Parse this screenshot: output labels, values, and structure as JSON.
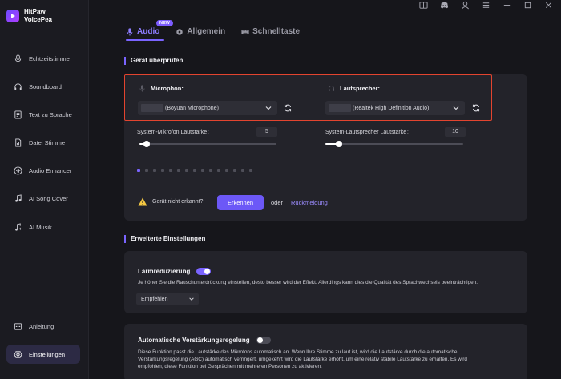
{
  "app": {
    "name_line1": "HitPaw",
    "name_line2": "VoicePea"
  },
  "sidebar": {
    "items": [
      {
        "label": "Echtzeitstimme",
        "icon": "microphone-icon"
      },
      {
        "label": "Soundboard",
        "icon": "headphones-icon"
      },
      {
        "label": "Text zu Sprache",
        "icon": "document-text-icon"
      },
      {
        "label": "Datei Stimme",
        "icon": "file-icon"
      },
      {
        "label": "Audio Enhancer",
        "icon": "waveform-icon"
      },
      {
        "label": "AI Song Cover",
        "icon": "music-note-icon"
      },
      {
        "label": "AI Musik",
        "icon": "music-ai-icon"
      }
    ],
    "bottom_items": [
      {
        "label": "Anleitung",
        "icon": "book-icon"
      },
      {
        "label": "Einstellungen",
        "icon": "gear-icon",
        "active": true
      }
    ]
  },
  "topbar": [
    "book-icon",
    "discord-icon",
    "user-icon",
    "menu-icon",
    "minimize-icon",
    "maximize-icon",
    "close-icon"
  ],
  "tabs": [
    {
      "label": "Audio",
      "icon": "microphone-icon",
      "active": true,
      "badge": "NEW"
    },
    {
      "label": "Allgemein",
      "icon": "gear-icon",
      "active": false
    },
    {
      "label": "Schnelltaste",
      "icon": "keyboard-icon",
      "active": false
    }
  ],
  "device_check": {
    "title": "Gerät überprüfen",
    "microphone": {
      "label": "Microphon:",
      "value": "(Boyuan Microphone)"
    },
    "speaker": {
      "label": "Lautsprecher:",
      "value": "(Realtek High Definition Audio)"
    },
    "mic_volume": {
      "label": "System-Mikrofon Lautstärke：",
      "value": "5",
      "level": 5
    },
    "speaker_volume": {
      "label": "System-Lautsprecher Lautstärke：",
      "value": "10",
      "level": 10
    },
    "level_meter": {
      "active_count": 1,
      "total_count": 15
    },
    "not_detected": "Gerät nicht erkannt?",
    "detect_button": "Erkennen",
    "or": "oder",
    "feedback_link": "Rückmeldung"
  },
  "advanced": {
    "title": "Erweiterte Einstellungen",
    "noise": {
      "title": "Lärmreduzierung",
      "enabled": true,
      "description": "Je höher Sie die Rauschunterdrückung einstellen, desto besser wird der Effekt. Allerdings kann dies die Qualität des Sprachwechsels beeinträchtigen.",
      "dropdown_value": "Empfehlen"
    },
    "agc": {
      "title": "Automatische Verstärkungsregelung",
      "enabled": false,
      "description_line1": "Diese Funktion passt die Lautstärke des Mikrofons automatisch an. Wenn Ihre Stimme zu laut ist, wird die Lautstärke durch die automatische",
      "description_line2": "Verstärkungsregelung (AGC) automatisch verringert, umgekehrt wird die Lautstärke erhöht, um eine relativ stabile Lautstärke zu erhalten. Es wird",
      "description_line3": "empfohlen, diese Funktion bei Gesprächen mit mehreren Personen zu aktivieren."
    }
  },
  "colors": {
    "accent": "#7a64ff",
    "highlight_border": "#e3442f",
    "background": "#16161b",
    "card": "#23232a"
  }
}
